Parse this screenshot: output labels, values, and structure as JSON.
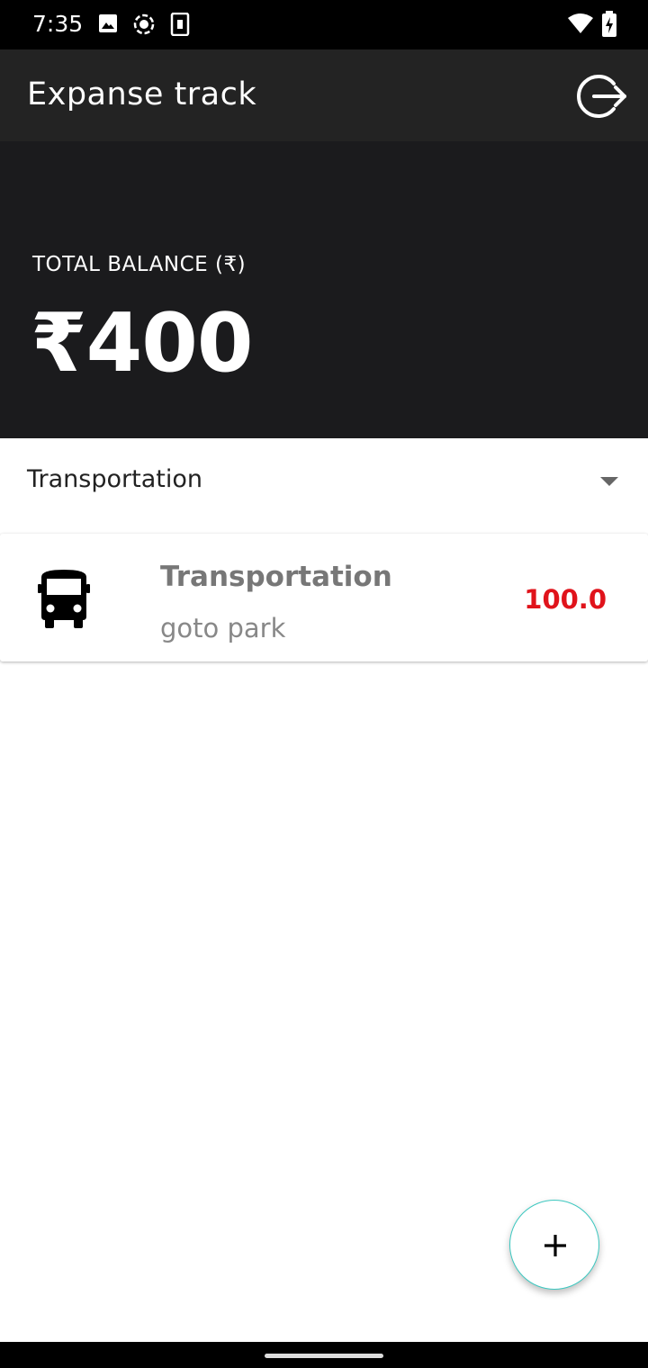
{
  "status_bar": {
    "time": "7:35",
    "left_icons": [
      "image-icon",
      "screen-record-icon",
      "sim-card-icon"
    ],
    "right_icons": [
      "wifi-icon",
      "battery-charging-icon"
    ]
  },
  "app_bar": {
    "title": "Expanse track",
    "logout_icon": "logout-icon"
  },
  "balance": {
    "label": "TOTAL BALANCE (₹)",
    "amount": "₹400"
  },
  "filter": {
    "selected_category": "Transportation"
  },
  "transactions": [
    {
      "icon": "bus-icon",
      "category": "Transportation",
      "note": "goto park",
      "amount": "100.0",
      "amount_color": "#e0131b"
    }
  ],
  "fab": {
    "icon": "plus-icon"
  },
  "colors": {
    "app_bar": "#232323",
    "balance_panel": "#1b1b1d",
    "expense_red": "#e0131b",
    "fab_border": "#3cc8c0"
  }
}
